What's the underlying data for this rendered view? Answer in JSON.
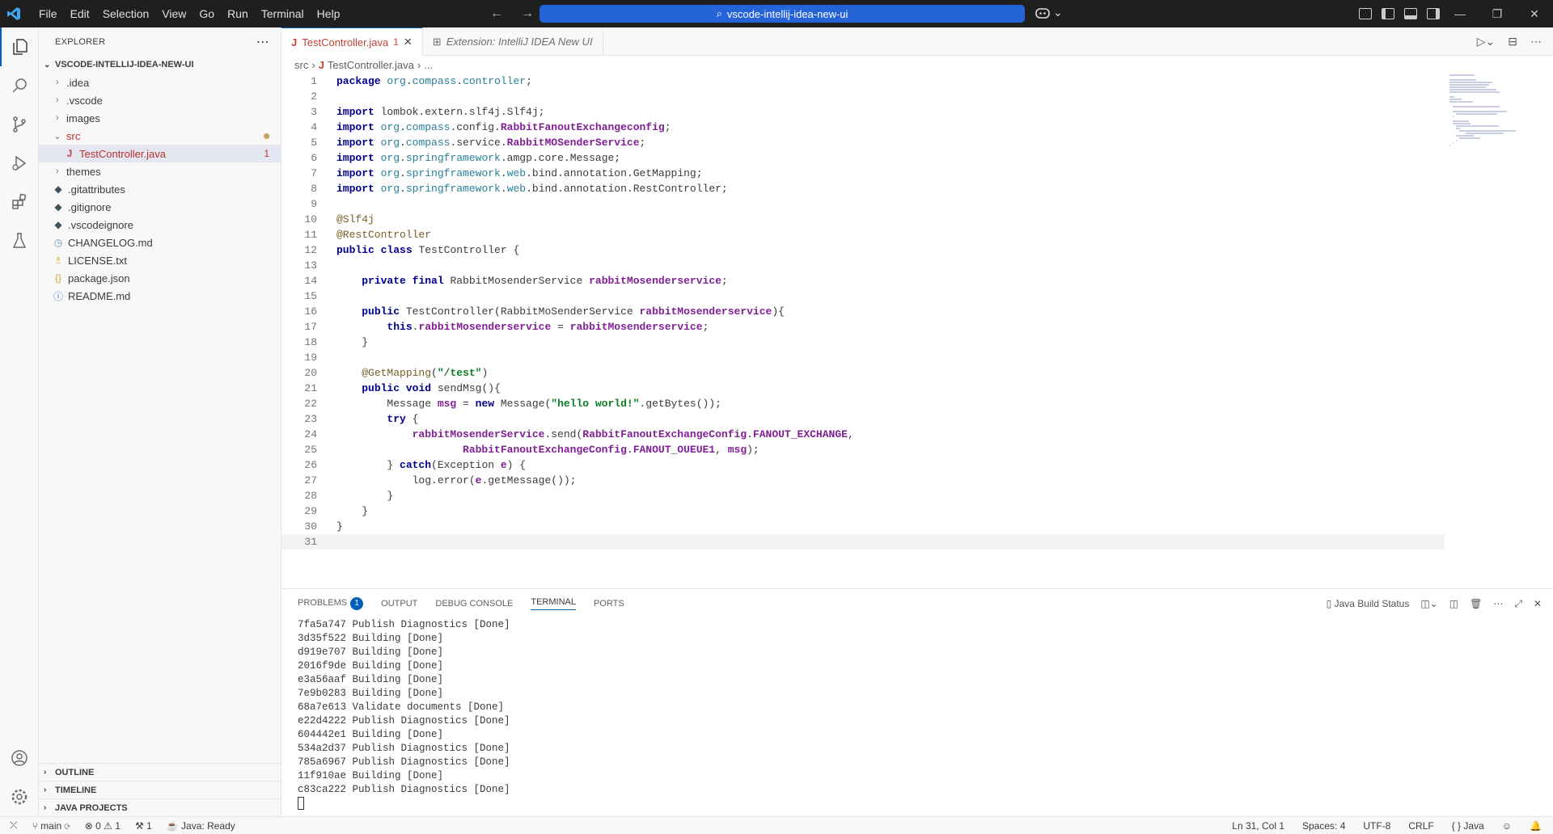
{
  "titlebar": {
    "menu": [
      "File",
      "Edit",
      "Selection",
      "View",
      "Go",
      "Run",
      "Terminal",
      "Help"
    ],
    "command_center": "vscode-intellij-idea-new-ui"
  },
  "sidebar": {
    "header": "EXPLORER",
    "root": "VSCODE-INTELLIJ-IDEA-NEW-UI",
    "items": [
      {
        "label": ".idea",
        "type": "folder",
        "depth": 0
      },
      {
        "label": ".vscode",
        "type": "folder",
        "depth": 0
      },
      {
        "label": "images",
        "type": "folder",
        "depth": 0
      },
      {
        "label": "src",
        "type": "folder-open",
        "depth": 0
      },
      {
        "label": "TestController.java",
        "type": "java",
        "depth": 1,
        "badge": "1"
      },
      {
        "label": "themes",
        "type": "folder",
        "depth": 0
      },
      {
        "label": ".gitattributes",
        "type": "git",
        "depth": 0
      },
      {
        "label": ".gitignore",
        "type": "git",
        "depth": 0
      },
      {
        "label": ".vscodeignore",
        "type": "git",
        "depth": 0
      },
      {
        "label": "CHANGELOG.md",
        "type": "changelog",
        "depth": 0
      },
      {
        "label": "LICENSE.txt",
        "type": "license",
        "depth": 0
      },
      {
        "label": "package.json",
        "type": "json",
        "depth": 0
      },
      {
        "label": "README.md",
        "type": "info",
        "depth": 0
      }
    ],
    "sections": [
      "OUTLINE",
      "TIMELINE",
      "JAVA PROJECTS"
    ]
  },
  "tabs": [
    {
      "label": "TestController.java",
      "badge": "1"
    },
    {
      "label": "Extension: IntelliJ IDEA New UI"
    }
  ],
  "breadcrumb": [
    "src",
    "TestController.java",
    "..."
  ],
  "code_lines": [
    "package org.compass.controller;",
    "",
    "import lombok.extern.slf4j.Slf4j;",
    "import org.compass.config.RabbitFanoutExchangeconfig;",
    "import org.compass.service.RabbitMOSenderService;",
    "import org.springframework.amgp.core.Message;",
    "import org.springframework.web.bind.annotation.GetMapping;",
    "import org.springframework.web.bind.annotation.RestController;",
    "",
    "@Slf4j",
    "@RestController",
    "public class TestController {",
    "",
    "    private final RabbitMosenderService rabbitMosenderservice;",
    "",
    "    public TestController(RabbitMoSenderService rabbitMosenderservice){",
    "        this.rabbitMosenderservice = rabbitMosenderservice;",
    "    }",
    "",
    "    @GetMapping(\"/test\")",
    "    public void sendMsg(){",
    "        Message msg = new Message(\"hello world!\".getBytes());",
    "        try {",
    "            rabbitMosenderService.send(RabbitFanoutExchangeConfig.FANOUT_EXCHANGE,",
    "                    RabbitFanoutExchangeConfig.FANOUT_OUEUE1, msg);",
    "        } catch(Exception e) {",
    "            log.error(e.getMessage());",
    "        }",
    "    }",
    "}",
    ""
  ],
  "panel": {
    "tabs": [
      "PROBLEMS",
      "OUTPUT",
      "DEBUG CONSOLE",
      "TERMINAL",
      "PORTS"
    ],
    "problems_count": "1",
    "java_build_status": "Java Build Status",
    "terminal_lines": [
      "7fa5a747 Publish Diagnostics [Done]",
      "3d35f522 Building [Done]",
      "d919e707 Building [Done]",
      "2016f9de Building [Done]",
      "e3a56aaf Building [Done]",
      "7e9b0283 Building [Done]",
      "68a7e613 Validate documents [Done]",
      "e22d4222 Publish Diagnostics [Done]",
      "604442e1 Building [Done]",
      "534a2d37 Publish Diagnostics [Done]",
      "785a6967 Publish Diagnostics [Done]",
      "11f910ae Building [Done]",
      "c83ca222 Publish Diagnostics [Done]"
    ]
  },
  "statusbar": {
    "branch": "main",
    "errors": "0",
    "warnings": "1",
    "ports": "1",
    "java_status": "Java: Ready",
    "position": "Ln 31, Col 1",
    "spaces": "Spaces: 4",
    "encoding": "UTF-8",
    "eol": "CRLF",
    "language": "Java"
  },
  "colors": {
    "accent": "#005fb8",
    "command_center": "#2563d9",
    "titlebar": "#1f1f1f"
  }
}
